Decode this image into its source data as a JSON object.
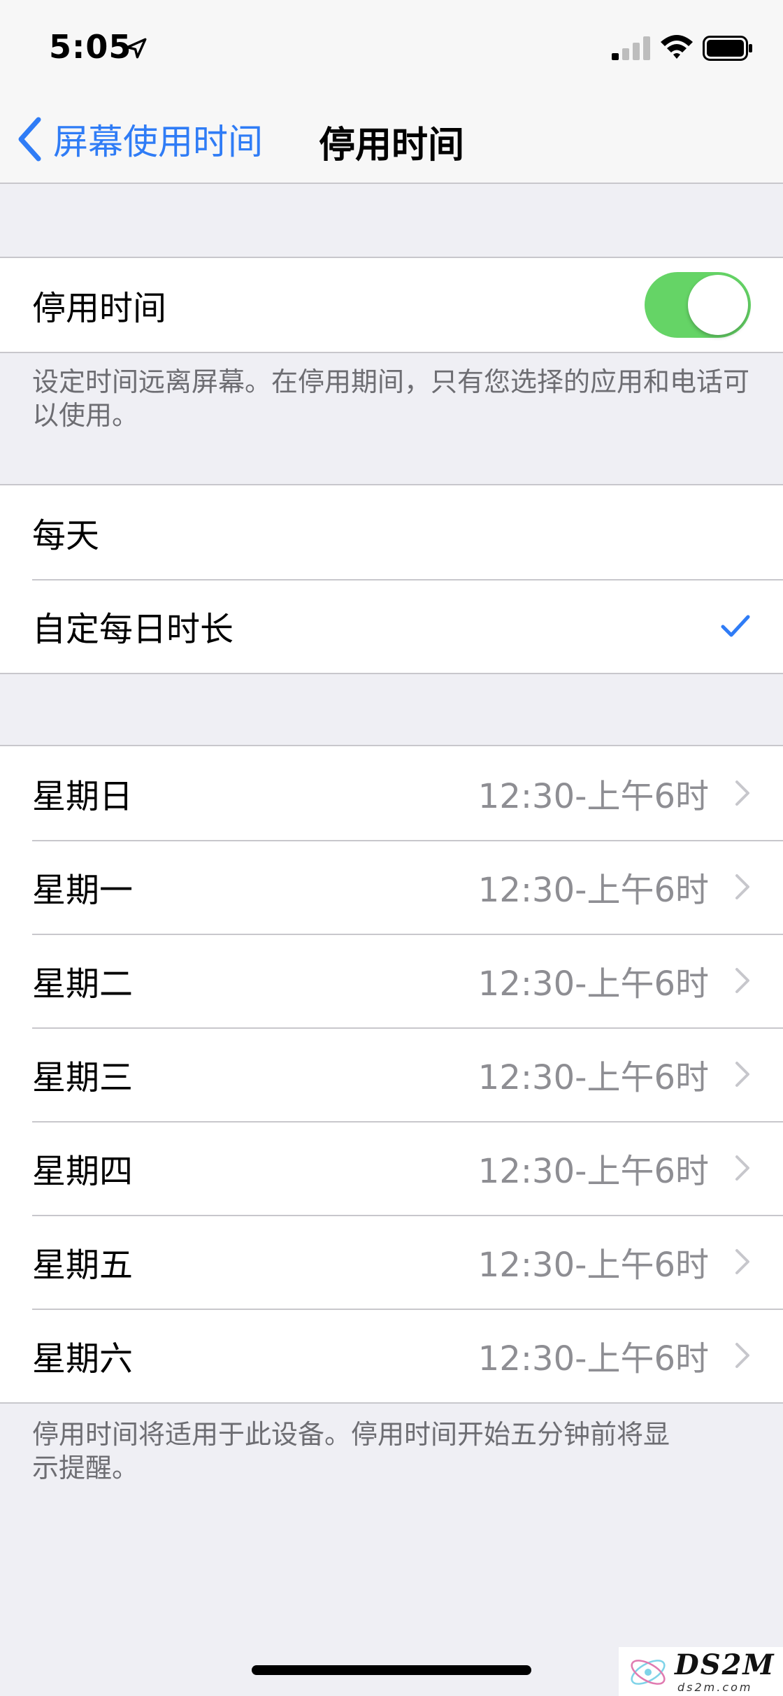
{
  "status_bar": {
    "time": "5:05"
  },
  "nav": {
    "back_label": "屏幕使用时间",
    "title": "停用时间"
  },
  "downtime_toggle": {
    "label": "停用时间",
    "enabled": true
  },
  "downtime_note": "设定时间远离屏幕。在停用期间，只有您选择的应用和电话可以使用。",
  "schedule_options": [
    {
      "label": "每天",
      "selected": false
    },
    {
      "label": "自定每日时长",
      "selected": true
    }
  ],
  "days": [
    {
      "day": "星期日",
      "time": "12:30-上午6时"
    },
    {
      "day": "星期一",
      "time": "12:30-上午6时"
    },
    {
      "day": "星期二",
      "time": "12:30-上午6时"
    },
    {
      "day": "星期三",
      "time": "12:30-上午6时"
    },
    {
      "day": "星期四",
      "time": "12:30-上午6时"
    },
    {
      "day": "星期五",
      "time": "12:30-上午6时"
    },
    {
      "day": "星期六",
      "time": "12:30-上午6时"
    }
  ],
  "days_note": "停用时间将适用于此设备。停用时间开始五分钟前将显示提醒。",
  "watermark": {
    "text": "DS2M",
    "sub": "ds2m.com"
  },
  "colors": {
    "accent": "#2f7cf6",
    "toggle_on": "#65d466",
    "background": "#efeff4"
  }
}
